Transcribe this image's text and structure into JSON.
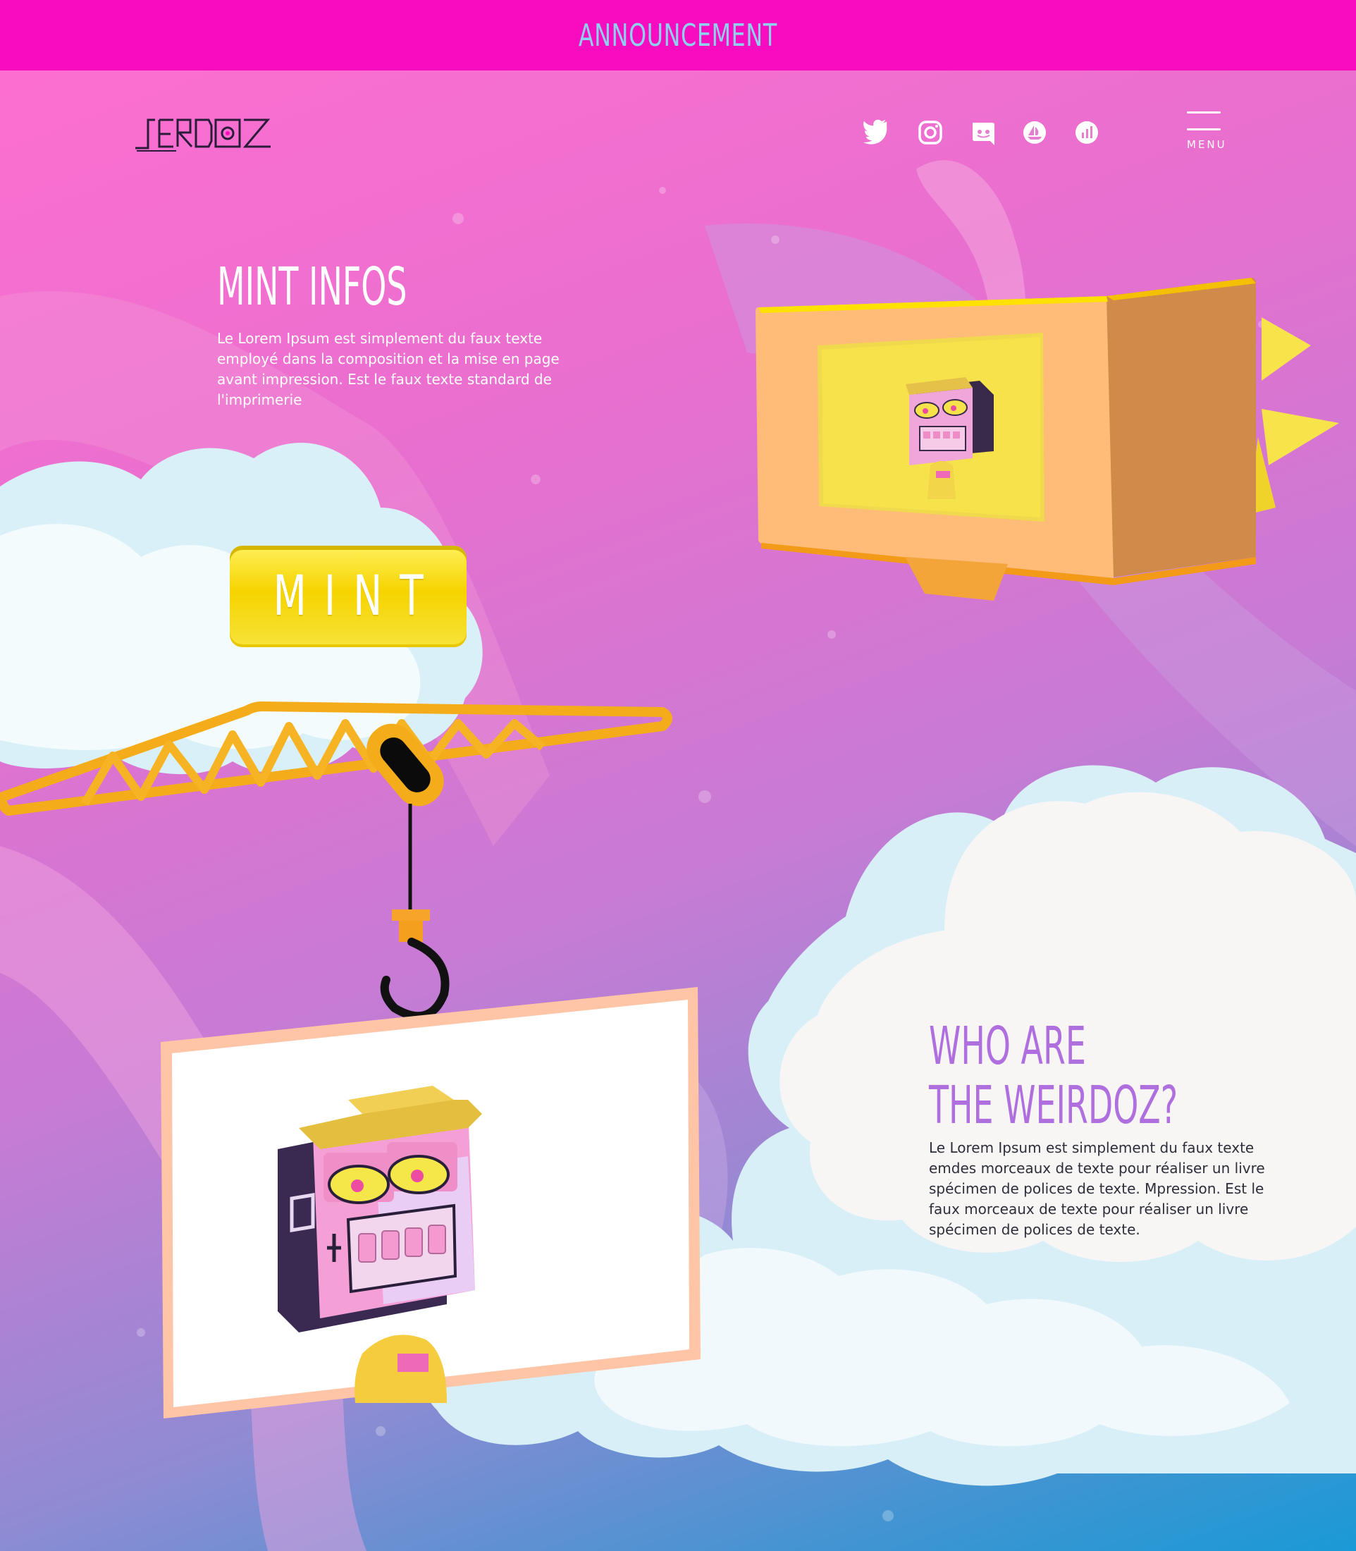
{
  "announcement": {
    "text": "ANNOUNCEMENT"
  },
  "header": {
    "logo_text": "JERDOZ",
    "social_icons": [
      "twitter-icon",
      "instagram-icon",
      "discord-icon",
      "opensea-icon",
      "chart-icon"
    ],
    "menu_label": "MENU"
  },
  "mint_infos": {
    "title": "MINT INFOS",
    "body": "Le Lorem Ipsum est simplement du faux texte employé dans la composition et la mise en page avant impression. Est le faux texte standard de l'imprimerie",
    "button_label": "MINT"
  },
  "who": {
    "title_line1": "WHO ARE",
    "title_line2": "THE WEIRDOZ?",
    "body": "Le Lorem Ipsum est simplement du faux texte emdes morceaux de texte pour réaliser un livre spécimen de polices de texte. Mpression. Est le faux morceaux de texte pour réaliser un livre spécimen de polices de texte."
  },
  "colors": {
    "announcement_bg": "#f80cc0",
    "announcement_text": "#8fd0ef",
    "accent_purple": "#b06fde",
    "mint_yellow": "#f5d400",
    "crane_orange": "#f7b51f"
  }
}
